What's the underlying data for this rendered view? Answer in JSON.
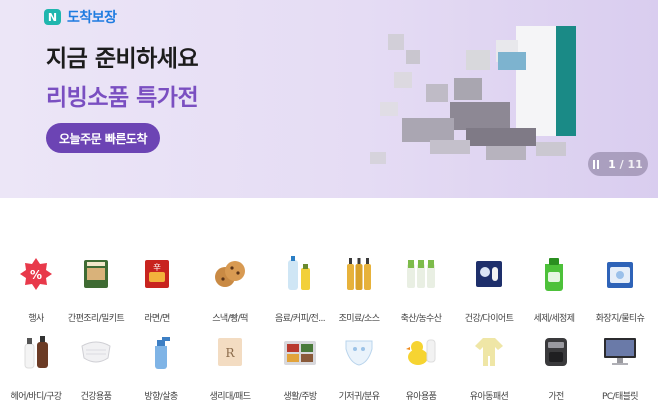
{
  "banner": {
    "badge_logo": "N",
    "badge_text": "도착보장",
    "headline": "지금 준비하세요",
    "subhead": "리빙소품 특가전",
    "cta_label": "오늘주문 빠른도착",
    "pager_current": "1",
    "pager_separator": "/",
    "pager_total": "11"
  },
  "categories": {
    "row1": [
      {
        "label": "행사",
        "icon": "sale-icon"
      },
      {
        "label": "간편조리/밀키트",
        "icon": "meal-kit-icon"
      },
      {
        "label": "라면/면",
        "icon": "ramen-icon"
      },
      {
        "label": "스낵/빵/떡",
        "icon": "cookie-icon"
      },
      {
        "label": "음료/커피/전...",
        "icon": "beverage-icon"
      },
      {
        "label": "조미료/소스",
        "icon": "sauce-icon"
      },
      {
        "label": "축산/농수산",
        "icon": "produce-icon"
      },
      {
        "label": "건강/다이어트",
        "icon": "supplement-icon"
      },
      {
        "label": "세제/세정제",
        "icon": "detergent-icon"
      },
      {
        "label": "화장지/물티슈",
        "icon": "tissue-icon"
      }
    ],
    "row2": [
      {
        "label": "헤어/바디/구강",
        "icon": "shampoo-icon"
      },
      {
        "label": "건강용품",
        "icon": "mask-icon"
      },
      {
        "label": "방향/살충",
        "icon": "spray-icon"
      },
      {
        "label": "생리대/패드",
        "icon": "pad-icon"
      },
      {
        "label": "생활/주방",
        "icon": "kitchen-icon"
      },
      {
        "label": "기저귀/분유",
        "icon": "diaper-icon"
      },
      {
        "label": "유아용품",
        "icon": "baby-toy-icon"
      },
      {
        "label": "유아동패션",
        "icon": "baby-clothes-icon"
      },
      {
        "label": "가전",
        "icon": "air-fryer-icon"
      },
      {
        "label": "PC/태블릿",
        "icon": "monitor-icon"
      }
    ]
  },
  "colors": {
    "brand_purple": "#6c44b4",
    "subhead_purple": "#7a4fc1",
    "badge_blue": "#1f7ce0",
    "badge_green": "#1fb6ae"
  }
}
